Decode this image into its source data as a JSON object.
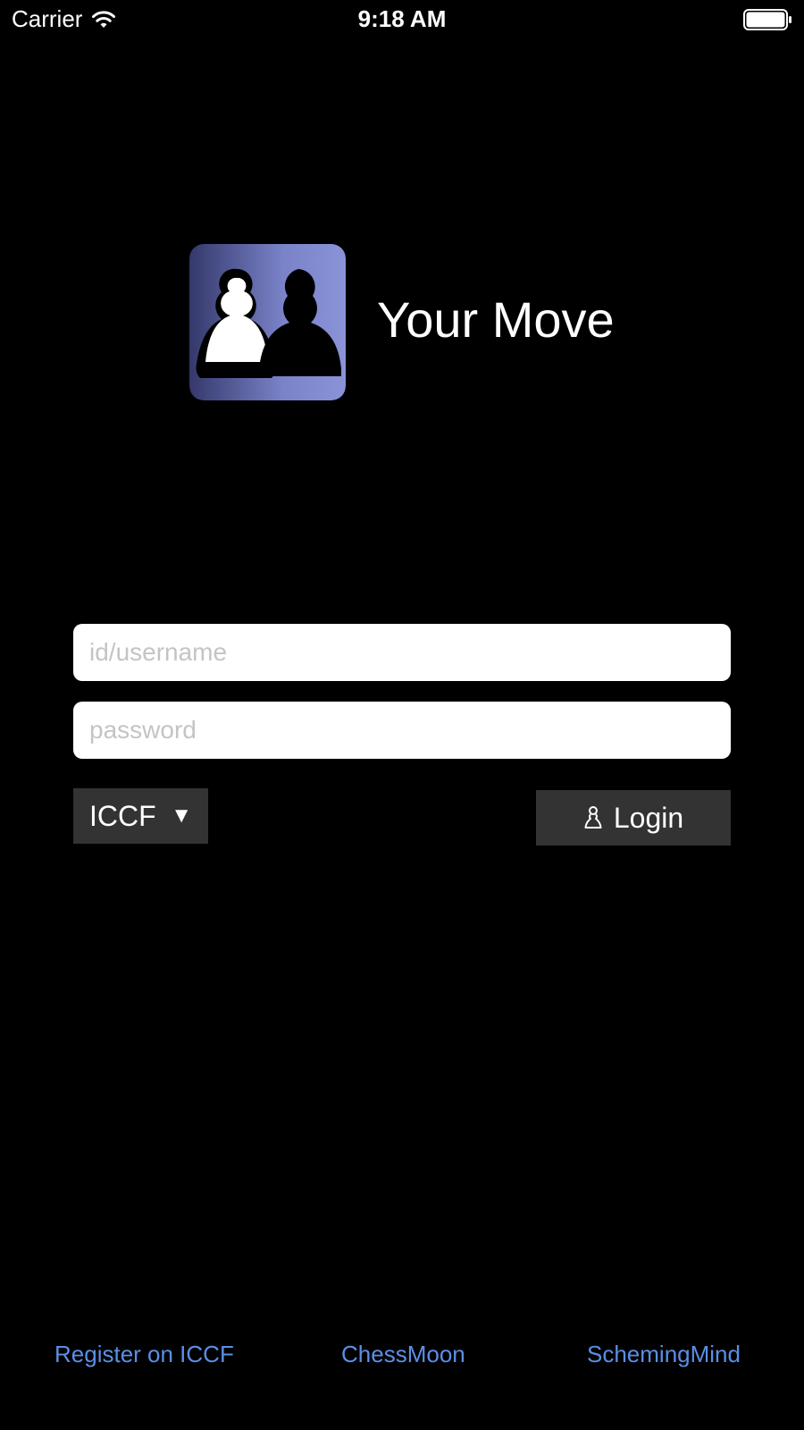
{
  "status_bar": {
    "carrier": "Carrier",
    "time": "9:18 AM",
    "battery_level": 1.0
  },
  "app": {
    "name": "Your Move",
    "logo_icon": "two-pawns-logo-icon"
  },
  "login_form": {
    "username_placeholder": "id/username",
    "username_value": "",
    "password_placeholder": "password",
    "password_value": "",
    "server_selected": "ICCF",
    "server_dropdown_icon": "triangle-down-icon",
    "login_label": "Login",
    "login_icon": "pawn-icon"
  },
  "footer": {
    "links": [
      {
        "label": "Register on ICCF"
      },
      {
        "label": "ChessMoon"
      },
      {
        "label": "SchemingMind"
      }
    ]
  },
  "colors": {
    "background": "#000000",
    "field_background": "#ffffff",
    "button_background": "#333333",
    "link": "#5b8fe6",
    "logo_gradient_start": "#34386b",
    "logo_gradient_end": "#8a93d8"
  }
}
